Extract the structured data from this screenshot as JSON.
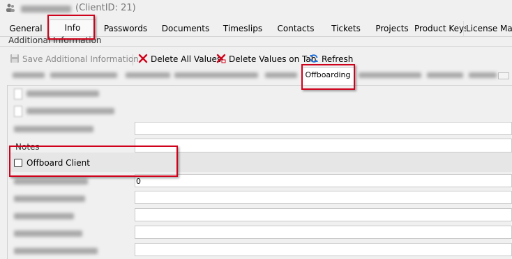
{
  "title_bar": {
    "client_id_text": "(ClientID: 21)",
    "app_icon": "people-icon"
  },
  "main_tabs": [
    {
      "label": "General"
    },
    {
      "label": "Info",
      "active": true
    },
    {
      "label": "Passwords"
    },
    {
      "label": "Documents"
    },
    {
      "label": "Timeslips"
    },
    {
      "label": "Contacts"
    },
    {
      "label": "Tickets"
    },
    {
      "label": "Projects"
    },
    {
      "label": "Product Keys"
    },
    {
      "label": "License Mana"
    }
  ],
  "group": {
    "label": "Additional Information"
  },
  "toolbar": {
    "save_label": "Save Additional Information",
    "delete_all_label": "Delete All Values",
    "delete_tab_label": "Delete Values on Tab",
    "refresh_label": "Refresh",
    "icons": [
      "save-icon",
      "red-x-icon",
      "red-x-tab-icon",
      "refresh-icon"
    ]
  },
  "sub_tabs": {
    "active_label": "Offboarding"
  },
  "content": {
    "notes_label": "Notes",
    "offboard_label": "Offboard Client",
    "offboard_checked": false,
    "zero_value": "0"
  },
  "colors": {
    "highlight": "#d0021b",
    "delete_red": "#d0021b",
    "refresh_blue": "#1e6fd9"
  }
}
